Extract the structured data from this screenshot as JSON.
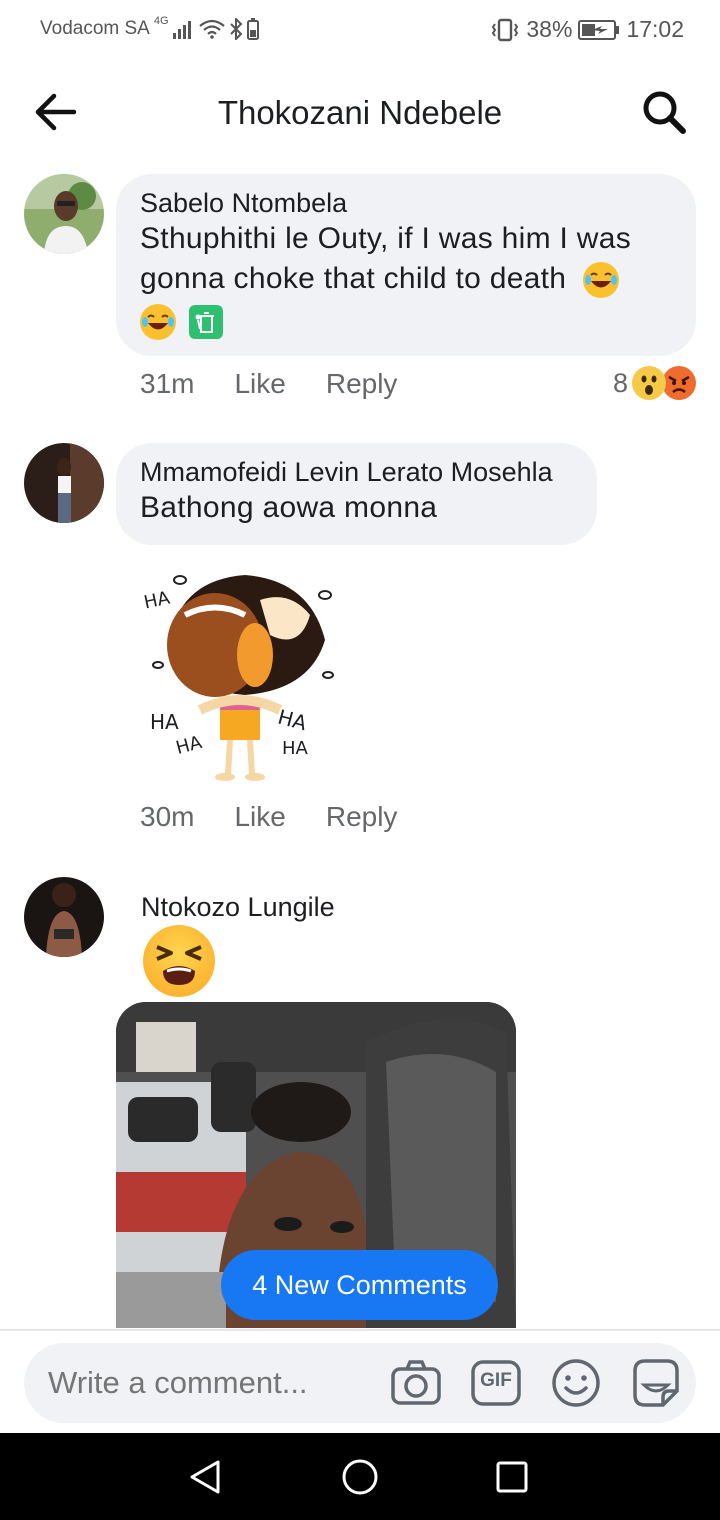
{
  "status_bar": {
    "carrier": "Vodacom SA",
    "network": "4G",
    "battery": "38%",
    "time": "17:02"
  },
  "header": {
    "title": "Thokozani Ndebele"
  },
  "comments": [
    {
      "author": "Sabelo Ntombela",
      "text_line1": "Sthuphithi le Outy, if I was him I was",
      "text_line2": "gonna choke that child to death",
      "time": "31m",
      "like": "Like",
      "reply": "Reply",
      "reaction_count": "8"
    },
    {
      "author": "Mmamofeidi Levin Lerato Mosehla",
      "text": "Bathong aowa monna",
      "time": "30m",
      "like": "Like",
      "reply": "Reply",
      "sticker_text": "HA"
    },
    {
      "author": "Ntokozo Lungile"
    }
  ],
  "new_comments_button": "4 New Comments",
  "composer": {
    "placeholder": "Write a comment...",
    "gif_label": "GIF"
  },
  "icons": {
    "back": "arrow-left-icon",
    "search": "search-icon",
    "camera": "camera-icon",
    "gif": "gif-icon",
    "emoji": "smiley-icon",
    "sticker": "sticker-icon"
  },
  "colors": {
    "accent": "#1877f2",
    "bubble": "#f0f2f5",
    "meta": "#65676b"
  }
}
